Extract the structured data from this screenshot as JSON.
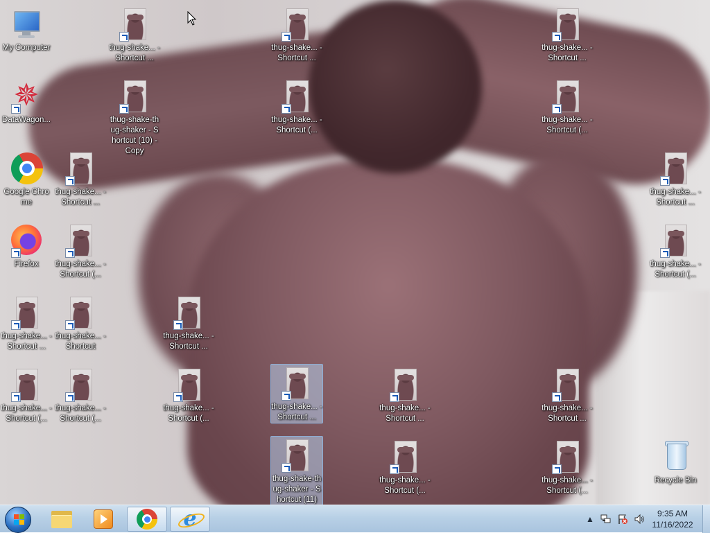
{
  "desktop": {
    "icons": [
      {
        "id": "my-computer",
        "label": "My Computer",
        "kind": "computer"
      },
      {
        "id": "datawagon",
        "label": "DataWagon...",
        "kind": "datawagon",
        "shortcut": true
      },
      {
        "id": "google-chrome",
        "label": "Google Chrome",
        "kind": "chrome"
      },
      {
        "id": "firefox",
        "label": "Firefox",
        "kind": "firefox",
        "shortcut": true
      },
      {
        "id": "ts-c1r5",
        "label": "thug-shake... - Shortcut ...",
        "kind": "thug",
        "shortcut": true
      },
      {
        "id": "ts-c1r6",
        "label": "thug-shake... - Shortcut (...",
        "kind": "thug",
        "shortcut": true
      },
      {
        "id": "ts-c2r3",
        "label": "thug-shake... - Shortcut ...",
        "kind": "thug",
        "shortcut": true
      },
      {
        "id": "ts-c2r4",
        "label": "thug-shake... - Shortcut (...",
        "kind": "thug",
        "shortcut": true
      },
      {
        "id": "ts-c2r5",
        "label": "thug-shake... - Shortcut",
        "kind": "thug",
        "shortcut": true
      },
      {
        "id": "ts-c2r6",
        "label": "thug-shake... - Shortcut (...",
        "kind": "thug",
        "shortcut": true
      },
      {
        "id": "ts-c3r1",
        "label": "thug-shake... - Shortcut ...",
        "kind": "thug",
        "shortcut": true
      },
      {
        "id": "ts-c3r2",
        "label": "thug-shake-thug-shaker - Shortcut (10) - Copy",
        "kind": "thug",
        "shortcut": true
      },
      {
        "id": "ts-c4r5",
        "label": "thug-shake... - Shortcut ...",
        "kind": "thug",
        "shortcut": true
      },
      {
        "id": "ts-c4r6",
        "label": "thug-shake... - Shortcut (...",
        "kind": "thug",
        "shortcut": true
      },
      {
        "id": "ts-c6r1",
        "label": "thug-shake... - Shortcut ...",
        "kind": "thug",
        "shortcut": true
      },
      {
        "id": "ts-c6r2",
        "label": "thug-shake... - Shortcut (...",
        "kind": "thug",
        "shortcut": true
      },
      {
        "id": "ts-c6r6",
        "label": "thug-shake... - Shortcut ...",
        "kind": "thug",
        "shortcut": true,
        "selected": true
      },
      {
        "id": "ts-c6r7",
        "label": "thug-shake-thug-shaker - Shortcut (11)",
        "kind": "thug",
        "shortcut": true,
        "selected": true
      },
      {
        "id": "ts-c8r6",
        "label": "thug-shake... - Shortcut ...",
        "kind": "thug",
        "shortcut": true
      },
      {
        "id": "ts-c8r7",
        "label": "thug-shake... - Shortcut (...",
        "kind": "thug",
        "shortcut": true
      },
      {
        "id": "ts-c11r1",
        "label": "thug-shake... - Shortcut ...",
        "kind": "thug",
        "shortcut": true
      },
      {
        "id": "ts-c11r2",
        "label": "thug-shake... - Shortcut (...",
        "kind": "thug",
        "shortcut": true
      },
      {
        "id": "ts-c11r6",
        "label": "thug-shake... - Shortcut ...",
        "kind": "thug",
        "shortcut": true
      },
      {
        "id": "ts-c11r7",
        "label": "thug-shake... - Shortcut (...",
        "kind": "thug",
        "shortcut": true
      },
      {
        "id": "ts-c13r3",
        "label": "thug-shake... - Shortcut ...",
        "kind": "thug",
        "shortcut": true
      },
      {
        "id": "ts-c13r4",
        "label": "thug-shake... - Shortcut (...",
        "kind": "thug",
        "shortcut": true
      },
      {
        "id": "recycle-bin",
        "label": "Recycle Bin",
        "kind": "bin"
      }
    ]
  },
  "taskbar": {
    "pinned": [
      {
        "id": "windows-explorer",
        "icon": "folder-icon"
      },
      {
        "id": "windows-media-player",
        "icon": "media-player-icon"
      },
      {
        "id": "google-chrome",
        "icon": "chrome-icon",
        "active": true
      },
      {
        "id": "internet-explorer",
        "icon": "internet-explorer-icon",
        "active": true
      }
    ],
    "tray": {
      "icons": [
        "show-hidden-icons-arrow",
        "network-icon",
        "action-center-flag-icon",
        "volume-icon"
      ],
      "time": "9:35 AM",
      "date": "11/16/2022"
    }
  },
  "colors": {
    "taskbar_top": "#cfe0ef",
    "taskbar_bottom": "#a9c4de",
    "selection": "#b4cdeb",
    "label_text": "#ffffff"
  }
}
